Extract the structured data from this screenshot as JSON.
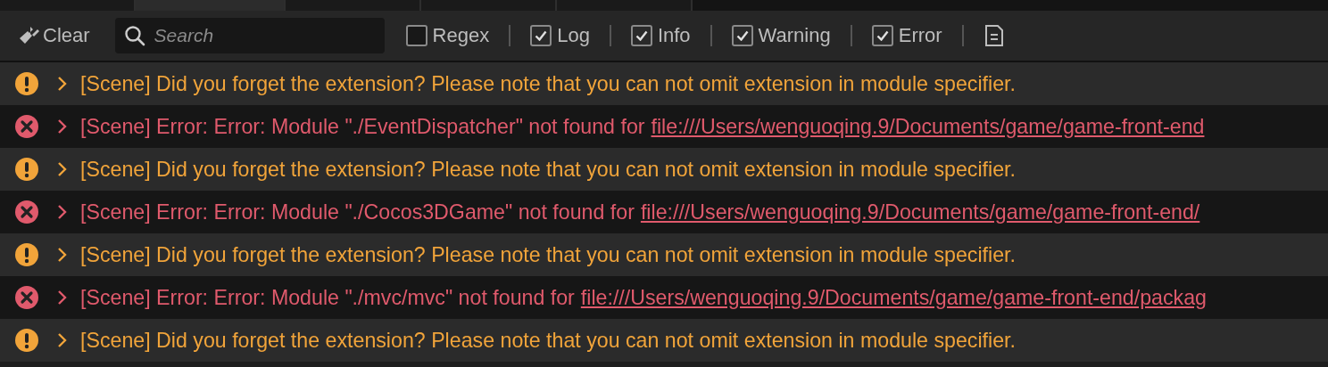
{
  "tabs": [
    {
      "selected": false
    },
    {
      "selected": true
    },
    {
      "selected": false
    },
    {
      "selected": false
    },
    {
      "selected": false
    }
  ],
  "toolbar": {
    "clear": "Clear",
    "search": {
      "placeholder": "Search"
    },
    "filters": [
      {
        "label": "Regex",
        "checked": false
      },
      {
        "label": "Log",
        "checked": true
      },
      {
        "label": "Info",
        "checked": true
      },
      {
        "label": "Warning",
        "checked": true
      },
      {
        "label": "Error",
        "checked": true
      }
    ]
  },
  "messages": [
    {
      "kind": "warning",
      "text": "[Scene] Did you forget the extension? Please note that you can not omit extension in module specifier."
    },
    {
      "kind": "error",
      "text": "[Scene] Error: Error: Module \"./EventDispatcher\" not found for",
      "link": "file:///Users/wenguoqing.9/Documents/game/game-front-end"
    },
    {
      "kind": "warning",
      "text": "[Scene] Did you forget the extension? Please note that you can not omit extension in module specifier."
    },
    {
      "kind": "error",
      "text": "[Scene] Error: Error: Module \"./Cocos3DGame\" not found for",
      "link": "file:///Users/wenguoqing.9/Documents/game/game-front-end/"
    },
    {
      "kind": "warning",
      "text": "[Scene] Did you forget the extension? Please note that you can not omit extension in module specifier."
    },
    {
      "kind": "error",
      "text": "[Scene] Error: Error: Module \"./mvc/mvc\" not found for",
      "link": "file:///Users/wenguoqing.9/Documents/game/game-front-end/packag"
    },
    {
      "kind": "warning",
      "text": "[Scene] Did you forget the extension? Please note that you can not omit extension in module specifier."
    }
  ]
}
